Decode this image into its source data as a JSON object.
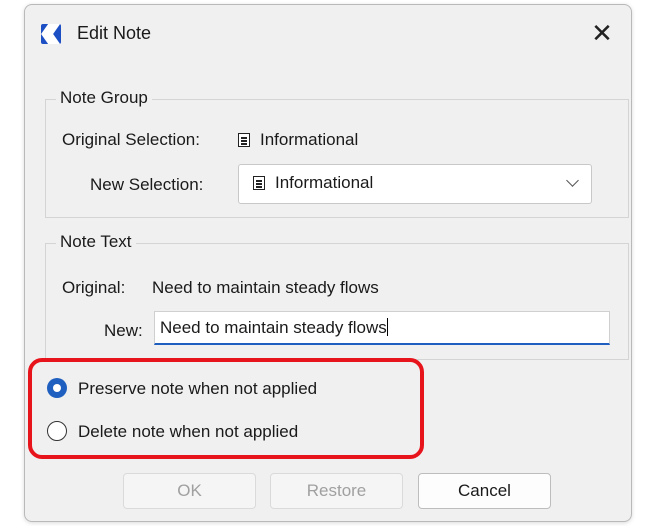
{
  "window": {
    "title": "Edit Note",
    "app_icon": "app-logo-icon",
    "close_icon": "close-icon"
  },
  "note_group": {
    "legend": "Note Group",
    "original_label": "Original Selection:",
    "original_value": "Informational",
    "new_label": "New Selection:",
    "new_value": "Informational",
    "item_icon": "document-list-icon"
  },
  "note_text": {
    "legend": "Note Text",
    "original_label": "Original:",
    "original_value": "Need to maintain steady flows",
    "new_label": "New:",
    "new_value": "Need to maintain steady flows"
  },
  "options": {
    "preserve_label": "Preserve note when not applied",
    "delete_label": "Delete note when not applied",
    "selected": "preserve"
  },
  "buttons": {
    "ok": "OK",
    "restore": "Restore",
    "cancel": "Cancel"
  },
  "colors": {
    "accent": "#1f5fbf",
    "highlight": "#e8141c"
  }
}
